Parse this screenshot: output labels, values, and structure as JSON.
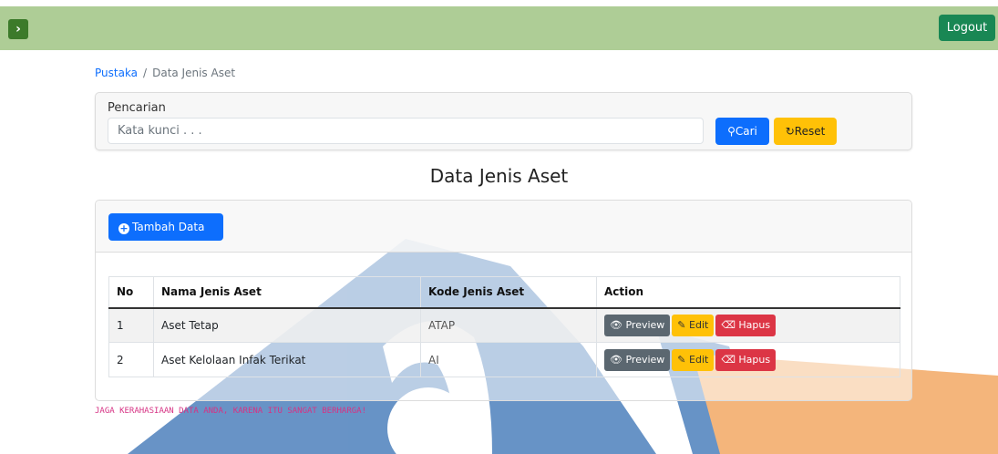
{
  "topbar": {
    "toggle_icon": "chevron-right-icon",
    "toggle_glyph": "›",
    "logout_label": "Logout",
    "colors": {
      "bar": "#aecd96",
      "logout": "#198754",
      "toggle": "#3c7a2a"
    }
  },
  "breadcrumb": {
    "parent": "Pustaka",
    "separator": "/",
    "current": "Data Jenis Aset"
  },
  "search": {
    "label": "Pencarian",
    "placeholder": "Kata kunci . . .",
    "search_icon": "search-icon",
    "search_button": "Cari",
    "reset_icon": "reset-icon",
    "reset_button": "Reset"
  },
  "page_title": "Data Jenis Aset",
  "toolbar": {
    "add_icon": "plus-circle-icon",
    "add_label": "Tambah Data"
  },
  "table": {
    "headers": {
      "no": "No",
      "nama": "Nama Jenis Aset",
      "kode": "Kode Jenis Aset",
      "action": "Action"
    },
    "rows": [
      {
        "no": "1",
        "nama": "Aset Tetap",
        "kode": "ATAP"
      },
      {
        "no": "2",
        "nama": "Aset Kelolaan Infak Terikat",
        "kode": "AI"
      }
    ],
    "actions": {
      "preview": "Preview",
      "edit": "Edit",
      "hapus": "Hapus"
    }
  },
  "footer_note": "JAGA KERAHASIAAN DATA ANDA, KARENA ITU SANGAT BERHARGA!"
}
